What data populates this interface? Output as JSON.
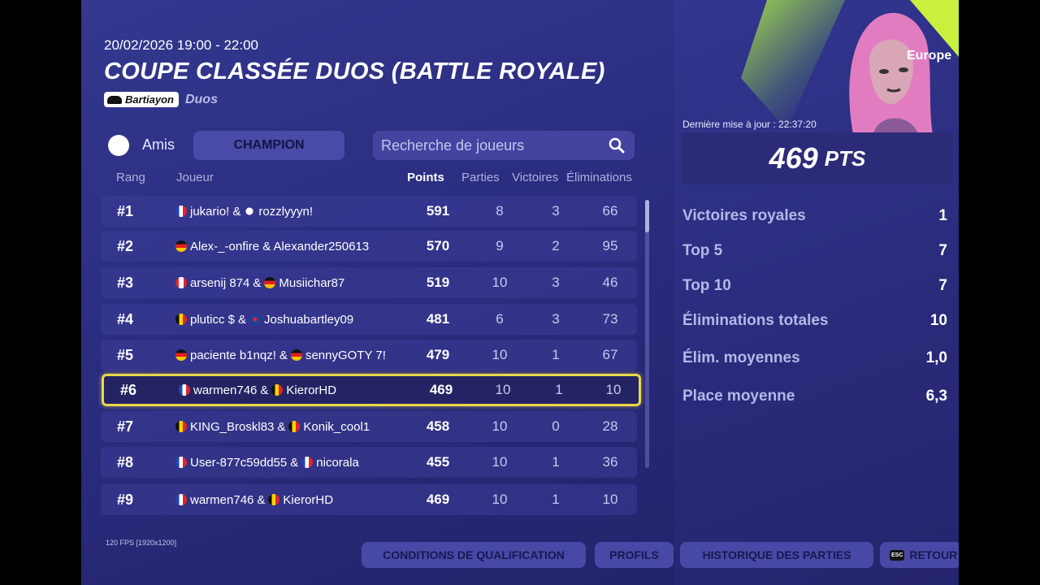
{
  "event": {
    "date": "20/02/2026 19:00 - 22:00",
    "title": "COUPE CLASSÉE DUOS (BATTLE ROYALE)",
    "badge_label": "Bartiayon",
    "mode": "Duos",
    "region": "Europe"
  },
  "controls": {
    "friends_label": "Amis",
    "division_label": "CHAMPION",
    "search_placeholder": "Recherche de joueurs"
  },
  "table": {
    "headers": {
      "rank": "Rang",
      "player": "Joueur",
      "points": "Points",
      "games": "Parties",
      "wins": "Victoires",
      "elims": "Éliminations"
    },
    "rows": [
      {
        "rank": "#1",
        "p1": "jukario!",
        "f1": "fr",
        "p2": "rozzlyyyn!",
        "f2": "skull",
        "points": "591",
        "games": "8",
        "wins": "3",
        "elims": "66"
      },
      {
        "rank": "#2",
        "p1": "Alex-_-onfire & Alexander250613",
        "f1": "de",
        "p2": "",
        "f2": "",
        "points": "570",
        "games": "9",
        "wins": "2",
        "elims": "95"
      },
      {
        "rank": "#3",
        "p1": "arsenij 874",
        "f1": "ca",
        "p2": "Musiichar87",
        "f2": "de",
        "points": "519",
        "games": "10",
        "wins": "3",
        "elims": "46"
      },
      {
        "rank": "#4",
        "p1": "pluticc $",
        "f1": "be",
        "p2": "Joshuabartley09",
        "f2": "gb",
        "points": "481",
        "games": "6",
        "wins": "3",
        "elims": "73"
      },
      {
        "rank": "#5",
        "p1": "paciente b1nqz!",
        "f1": "de",
        "p2": "sennyGOTY 7!",
        "f2": "de",
        "points": "479",
        "games": "10",
        "wins": "1",
        "elims": "67"
      },
      {
        "rank": "#6",
        "p1": "warmen746",
        "f1": "fr",
        "p2": "KierorHD",
        "f2": "be",
        "points": "469",
        "games": "10",
        "wins": "1",
        "elims": "10"
      },
      {
        "rank": "#7",
        "p1": "KING_Broskl83",
        "f1": "be",
        "p2": "Konik_cool1",
        "f2": "be",
        "points": "458",
        "games": "10",
        "wins": "0",
        "elims": "28"
      },
      {
        "rank": "#8",
        "p1": "User-877c59dd55",
        "f1": "fr",
        "p2": "nicorala",
        "f2": "fr",
        "points": "455",
        "games": "10",
        "wins": "1",
        "elims": "36"
      },
      {
        "rank": "#9",
        "p1": "warmen746",
        "f1": "fr",
        "p2": "KierorHD",
        "f2": "be",
        "points": "469",
        "games": "10",
        "wins": "1",
        "elims": "10"
      }
    ],
    "highlight_index": 5
  },
  "summary": {
    "updated": "Dernière mise à jour : 22:37:20",
    "points": "469",
    "points_unit": "PTS",
    "stats": [
      {
        "label": "Victoires royales",
        "value": "1"
      },
      {
        "label": "Top 5",
        "value": "7"
      },
      {
        "label": "Top 10",
        "value": "7"
      },
      {
        "label": "Éliminations totales",
        "value": "10"
      },
      {
        "label": "Élim. moyennes",
        "value": "1,0"
      },
      {
        "label": "Place moyenne",
        "value": "6,3"
      }
    ]
  },
  "footer": {
    "fps": "120 FPS [1920x1200]",
    "btn_qualif": "CONDITIONS DE QUALIFICATION",
    "btn_profiles": "PROFILS",
    "btn_history": "HISTORIQUE DES PARTIES",
    "esc_key": "ESC",
    "btn_back": "RETOUR"
  },
  "colors": {
    "highlight": "#e8d84a",
    "accent_green": "#c8f03c"
  }
}
